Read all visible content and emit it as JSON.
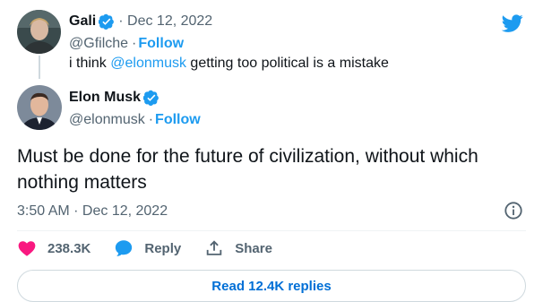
{
  "parent_tweet": {
    "display_name": "Gali",
    "date": "Dec 12, 2022",
    "handle": "@Gfilche",
    "follow_label": "Follow",
    "text_before": "i think ",
    "mention": "@elonmusk",
    "text_after": " getting too political is a mistake"
  },
  "main_tweet": {
    "display_name": "Elon Musk",
    "handle": "@elonmusk",
    "follow_label": "Follow",
    "text": "Must be done for the future of civilization, without which nothing matters",
    "timestamp": "3:50 AM · Dec 12, 2022"
  },
  "actions": {
    "likes": "238.3K",
    "reply_label": "Reply",
    "share_label": "Share"
  },
  "read_replies_label": "Read 12.4K replies",
  "colors": {
    "twitter_blue": "#1d9bf0",
    "like_red": "#f91880",
    "text_primary": "#0f1419",
    "text_secondary": "#536471"
  },
  "icons": [
    "twitter-bird-icon",
    "verified-badge-icon",
    "info-icon",
    "heart-icon",
    "reply-bubble-icon",
    "share-icon"
  ]
}
